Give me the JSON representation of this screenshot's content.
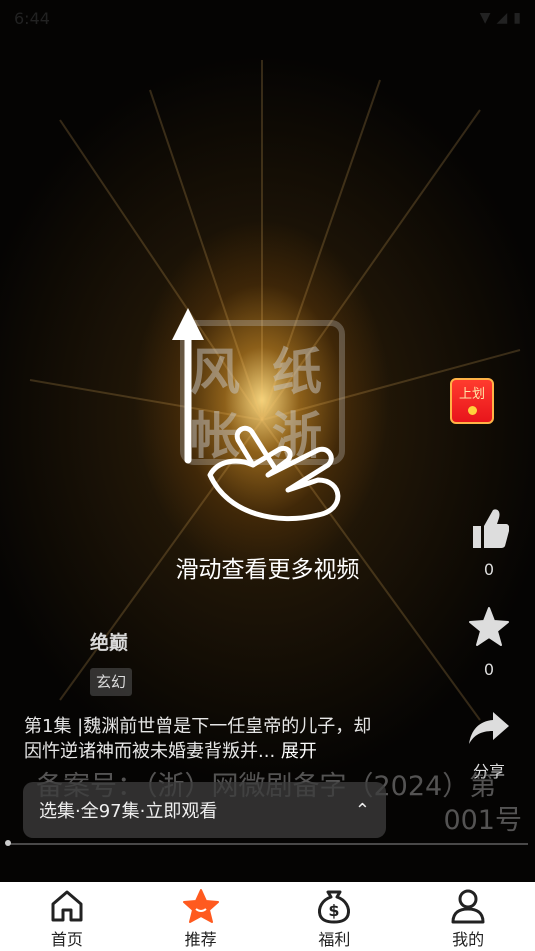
{
  "status_bar": {
    "time": "6:44",
    "icons": [
      "wifi-icon",
      "signal-icon",
      "battery-icon"
    ]
  },
  "overlay": {
    "swipe_hint": "滑动查看更多视频",
    "logo_chars": [
      "风",
      "纸",
      "帐",
      "浙"
    ]
  },
  "promo_badge": {
    "label": "上划"
  },
  "actions": {
    "like": {
      "count": "0"
    },
    "favorite": {
      "count": "0"
    },
    "share": {
      "label": "分享"
    }
  },
  "series": {
    "title": "绝巅",
    "genre": "玄幻",
    "description": "第1集 |魏渊前世曾是下一任皇帝的儿子，却因忤逆诸神而被未婚妻背叛并...",
    "expand_label": "展开"
  },
  "record": {
    "line1": "备案号：（浙）网微剧备字（2024）第",
    "line2": "001号"
  },
  "episode_bar": {
    "label": "选集·全97集·立即观看"
  },
  "tabs": [
    {
      "label": "首页",
      "icon": "home-icon"
    },
    {
      "label": "推荐",
      "icon": "star-icon",
      "active": true
    },
    {
      "label": "福利",
      "icon": "dollar-bag-icon"
    },
    {
      "label": "我的",
      "icon": "user-icon"
    }
  ],
  "colors": {
    "accent": "#ff5a1f",
    "promo_red": "#e8151b"
  }
}
